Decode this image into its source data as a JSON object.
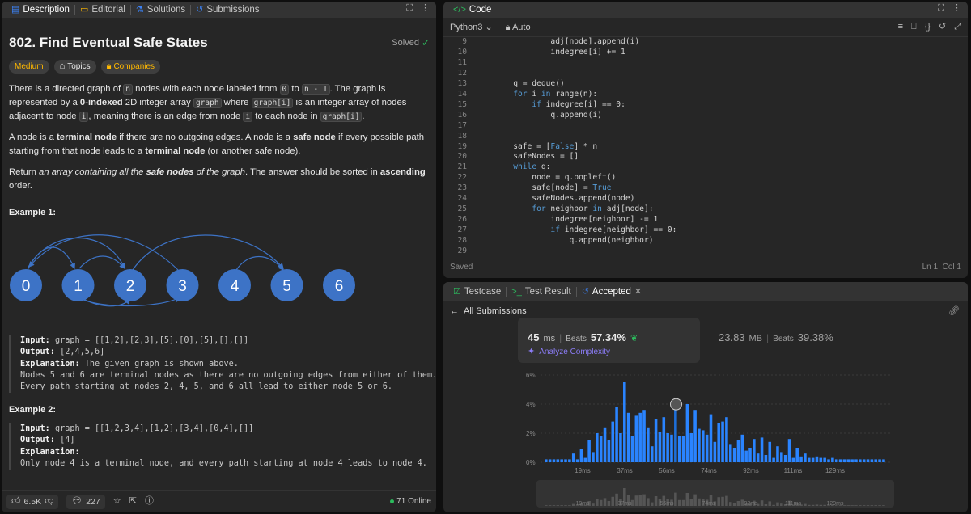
{
  "left_panel": {
    "tabs": [
      {
        "label": "Description",
        "icon": "description-icon"
      },
      {
        "label": "Editorial",
        "icon": "book-icon"
      },
      {
        "label": "Solutions",
        "icon": "flask-icon"
      },
      {
        "label": "Submissions",
        "icon": "history-icon"
      }
    ],
    "title": "802. Find Eventual Safe States",
    "solved_label": "Solved",
    "tags": {
      "difficulty": "Medium",
      "topics": "Topics",
      "companies": "Companies"
    },
    "description": {
      "p1_a": "There is a directed graph of ",
      "p1_n": "n",
      "p1_b": " nodes with each node labeled from ",
      "p1_zero": "0",
      "p1_c": " to ",
      "p1_nm1": "n - 1",
      "p1_d": ". The graph is represented by a ",
      "p1_bold": "0-indexed",
      "p1_e": " 2D integer array ",
      "p1_graph": "graph",
      "p1_f": " where ",
      "p1_graphi": "graph[i]",
      "p1_g": " is an integer array of nodes adjacent to node ",
      "p1_i": "i",
      "p1_h": ", meaning there is an edge from node ",
      "p1_i2": "i",
      "p1_j": " to each node in ",
      "p1_graphi2": "graph[i]",
      "p1_k": ".",
      "p2_a": "A node is a ",
      "p2_term": "terminal node",
      "p2_b": " if there are no outgoing edges. A node is a ",
      "p2_safe": "safe node",
      "p2_c": " if every possible path starting from that node leads to a ",
      "p2_term2": "terminal node",
      "p2_d": " (or another safe node).",
      "p3_a": "Return ",
      "p3_em1": "an array containing all the ",
      "p3_safe": "safe nodes",
      "p3_em2": " of the graph",
      "p3_b": ". The answer should be sorted in ",
      "p3_asc": "ascending",
      "p3_c": " order."
    },
    "example1_title": "Example 1:",
    "graph_nodes": [
      "0",
      "1",
      "2",
      "3",
      "4",
      "5",
      "6"
    ],
    "example1": {
      "input_label": "Input:",
      "input": " graph = [[1,2],[2,3],[5],[0],[5],[],[]]",
      "output_label": "Output:",
      "output": " [2,4,5,6]",
      "explanation_label": "Explanation:",
      "explanation": " The given graph is shown above.",
      "line2": "Nodes 5 and 6 are terminal nodes as there are no outgoing edges from either of them.",
      "line3": "Every path starting at nodes 2, 4, 5, and 6 all lead to either node 5 or 6."
    },
    "example2_title": "Example 2:",
    "example2": {
      "input_label": "Input:",
      "input": " graph = [[1,2,3,4],[1,2],[3,4],[0,4],[]]",
      "output_label": "Output:",
      "output": " [4]",
      "explanation_label": "Explanation:",
      "line2": "Only node 4 is a terminal node, and every path starting at node 4 leads to node 4."
    },
    "bottom": {
      "likes": "6.5K",
      "comments": "227",
      "online": "71 Online"
    }
  },
  "code_panel": {
    "tab_label": "Code",
    "language": "Python3",
    "auto_label": "Auto",
    "status": "Saved",
    "cursor": "Ln 1, Col 1",
    "lines": [
      {
        "n": "9",
        "t": "                adj[node].append(i)"
      },
      {
        "n": "10",
        "t": "                indegree[i] += 1"
      },
      {
        "n": "11",
        "t": ""
      },
      {
        "n": "12",
        "t": ""
      },
      {
        "n": "13",
        "t": "        q = deque()"
      },
      {
        "n": "14",
        "t": "        for i in range(n):"
      },
      {
        "n": "15",
        "t": "            if indegree[i] == 0:"
      },
      {
        "n": "16",
        "t": "                q.append(i)"
      },
      {
        "n": "17",
        "t": ""
      },
      {
        "n": "18",
        "t": ""
      },
      {
        "n": "19",
        "t": "        safe = [False] * n"
      },
      {
        "n": "20",
        "t": "        safeNodes = []"
      },
      {
        "n": "21",
        "t": "        while q:"
      },
      {
        "n": "22",
        "t": "            node = q.popleft()"
      },
      {
        "n": "23",
        "t": "            safe[node] = True"
      },
      {
        "n": "24",
        "t": "            safeNodes.append(node)"
      },
      {
        "n": "25",
        "t": "            for neighbor in adj[node]:"
      },
      {
        "n": "26",
        "t": "                indegree[neighbor] -= 1"
      },
      {
        "n": "27",
        "t": "                if indegree[neighbor] == 0:"
      },
      {
        "n": "28",
        "t": "                    q.append(neighbor)"
      },
      {
        "n": "29",
        "t": ""
      }
    ]
  },
  "result_panel": {
    "tabs": [
      "Testcase",
      "Test Result",
      "Accepted"
    ],
    "back_label": "All Submissions",
    "runtime_value": "45",
    "runtime_unit": "ms",
    "runtime_beats_label": "Beats",
    "runtime_beats": "57.34%",
    "analyze_label": "Analyze Complexity",
    "memory_value": "23.83",
    "memory_unit": "MB",
    "memory_beats_label": "Beats",
    "memory_beats": "39.38%"
  },
  "chart_data": {
    "type": "bar",
    "ylabel": "",
    "xlabel": "",
    "y_ticks": [
      "6%",
      "4%",
      "2%",
      "0%"
    ],
    "ylim": [
      0,
      6
    ],
    "x_ticks": [
      "19ms",
      "37ms",
      "56ms",
      "74ms",
      "92ms",
      "111ms",
      "129ms"
    ],
    "values": [
      0.2,
      0.2,
      0.2,
      0.2,
      0.2,
      0.2,
      0.2,
      0.6,
      0.2,
      0.9,
      0.3,
      1.5,
      0.7,
      2.0,
      1.8,
      2.4,
      1.5,
      2.8,
      3.8,
      2.0,
      5.5,
      3.4,
      1.8,
      3.2,
      3.4,
      3.6,
      2.4,
      1.1,
      3.0,
      2.1,
      3.1,
      2.0,
      1.9,
      4.1,
      1.8,
      1.8,
      4.0,
      2.0,
      3.6,
      2.3,
      2.2,
      1.9,
      3.3,
      1.4,
      2.7,
      2.8,
      3.1,
      1.2,
      1.0,
      1.5,
      1.9,
      0.8,
      1.0,
      1.6,
      0.6,
      1.7,
      0.5,
      1.4,
      0.3,
      1.1,
      0.7,
      0.5,
      1.6,
      0.3,
      1.0,
      0.4,
      0.6,
      0.3,
      0.3,
      0.4,
      0.3,
      0.3,
      0.2,
      0.3,
      0.2,
      0.2,
      0.2,
      0.2,
      0.2,
      0.2,
      0.2,
      0.2,
      0.2,
      0.2,
      0.2,
      0.2,
      0.2
    ],
    "highlight_index": 33,
    "colors": {
      "bar": "#2a84ff",
      "highlight": "#1e6fd8",
      "grid": "#3a3a3a",
      "accent_green": "#2cbb5d",
      "accent_yellow": "#ffb800",
      "node_fill": "#3d73c6"
    }
  }
}
